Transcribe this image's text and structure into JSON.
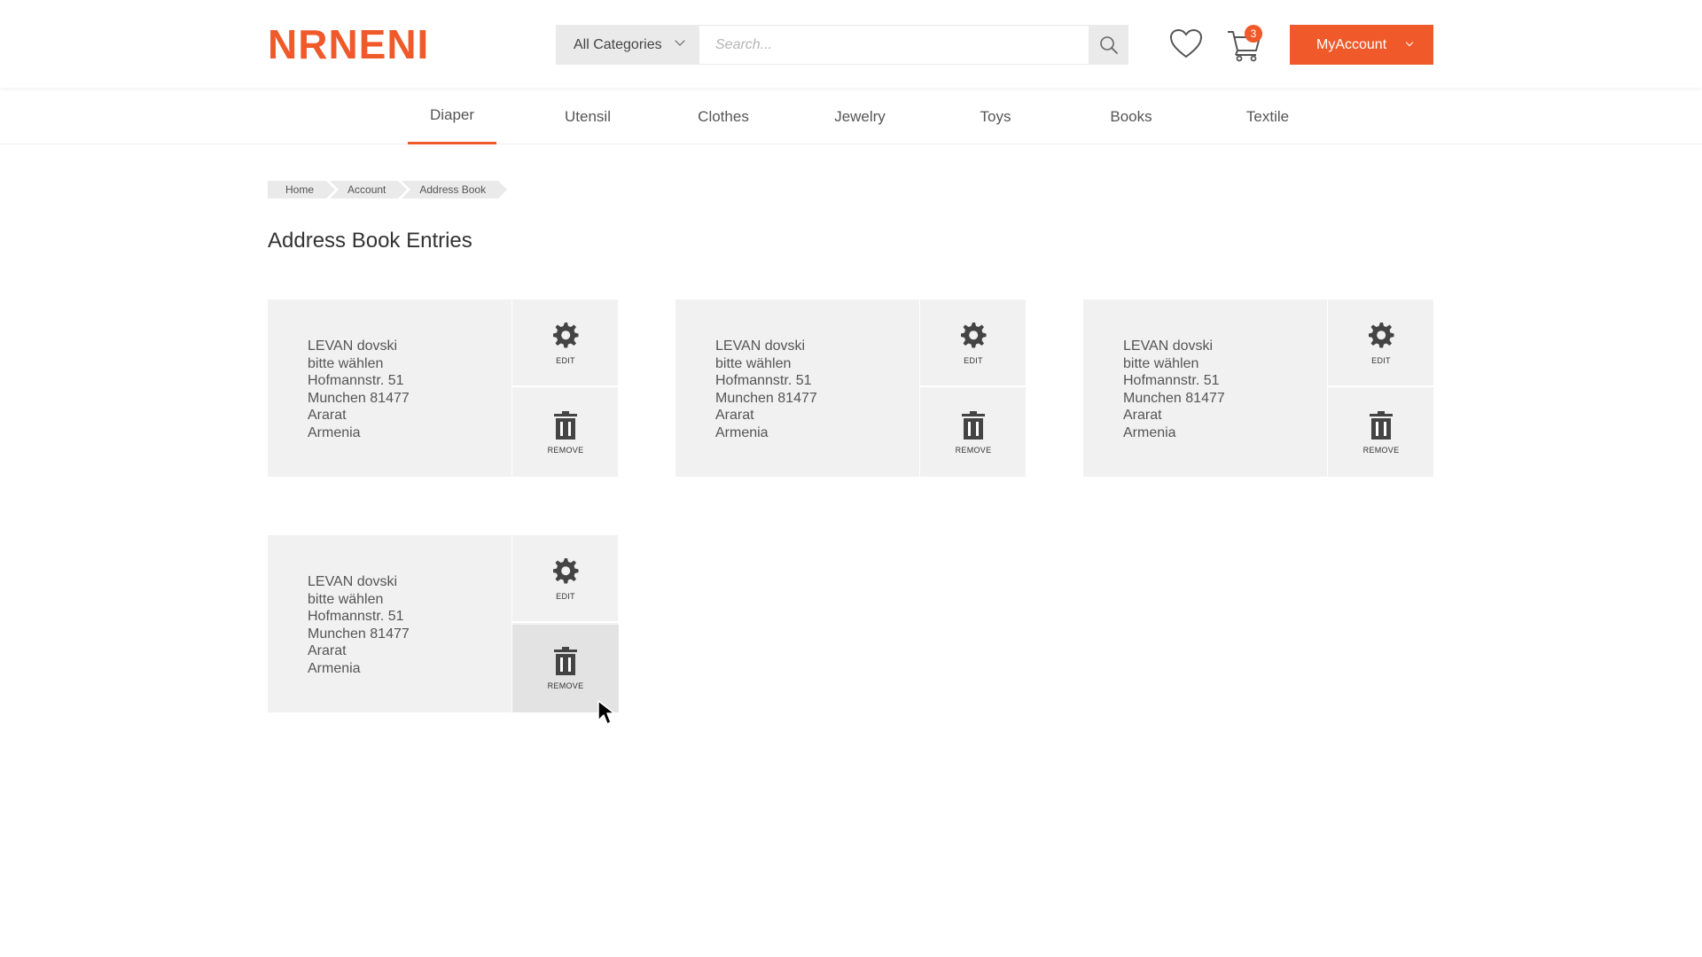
{
  "header": {
    "logo": "NRNENI",
    "category_select": "All Categories",
    "search_placeholder": "Search...",
    "cart_count": "3",
    "account_label": "MyAccount"
  },
  "nav": {
    "items": [
      {
        "label": "Diaper"
      },
      {
        "label": "Utensil"
      },
      {
        "label": "Clothes"
      },
      {
        "label": "Jewelry"
      },
      {
        "label": "Toys"
      },
      {
        "label": "Books"
      },
      {
        "label": "Textile"
      }
    ]
  },
  "breadcrumb": [
    "Home",
    "Account",
    "Address Book"
  ],
  "page_title": "Address Book Entries",
  "entries": [
    {
      "name": "LEVAN dovski",
      "line2": "bitte wählen",
      "street": "Hofmannstr. 51",
      "city": "Munchen 81477",
      "region": "Ararat",
      "country": "Armenia",
      "edit": "EDIT",
      "remove": "REMOVE"
    },
    {
      "name": "LEVAN dovski",
      "line2": "bitte wählen",
      "street": "Hofmannstr. 51",
      "city": "Munchen 81477",
      "region": "Ararat",
      "country": "Armenia",
      "edit": "EDIT",
      "remove": "REMOVE"
    },
    {
      "name": "LEVAN dovski",
      "line2": "bitte wählen",
      "street": "Hofmannstr. 51",
      "city": "Munchen 81477",
      "region": "Ararat",
      "country": "Armenia",
      "edit": "EDIT",
      "remove": "REMOVE"
    },
    {
      "name": "LEVAN dovski",
      "line2": "bitte wählen",
      "street": "Hofmannstr. 51",
      "city": "Munchen 81477",
      "region": "Ararat",
      "country": "Armenia",
      "edit": "EDIT",
      "remove": "REMOVE"
    }
  ],
  "colors": {
    "accent": "#f0592a",
    "card_bg": "#f1f1f1",
    "hover_bg": "#e3e3e3"
  }
}
